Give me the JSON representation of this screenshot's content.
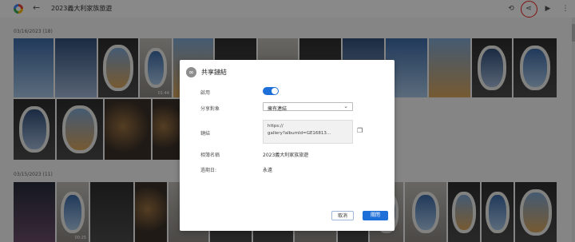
{
  "header": {
    "album_title": "2023義大利家族旅遊",
    "back_icon": "back-arrow-icon",
    "icons": [
      "history-icon",
      "share-icon",
      "slideshow-icon",
      "more-icon"
    ]
  },
  "sections": [
    {
      "date_label": "03/16/2023 (18)"
    },
    {
      "date_label": "03/15/2023 (11)"
    }
  ],
  "photos": {
    "duration_1": "01:44",
    "duration_2": "00:25"
  },
  "dialog": {
    "title": "共享鏈結",
    "rows": {
      "enable_label": "啟用",
      "enable_on": true,
      "share_with_label": "分享對象",
      "share_with_value": "擁有連結",
      "link_label": "鏈結",
      "link_line1": "https://",
      "link_line2": "gallery?albumId=GE16813...",
      "link_line3": "",
      "album_name_label": "相簿名稱",
      "album_name_value": "2023義大利家族旅遊",
      "expiry_label": "過期日:",
      "expiry_value": "永遠"
    },
    "buttons": {
      "cancel": "取消",
      "close": "關閉"
    }
  },
  "colors": {
    "accent": "#1f6fd8",
    "highlight_circle": "#e8221c"
  }
}
